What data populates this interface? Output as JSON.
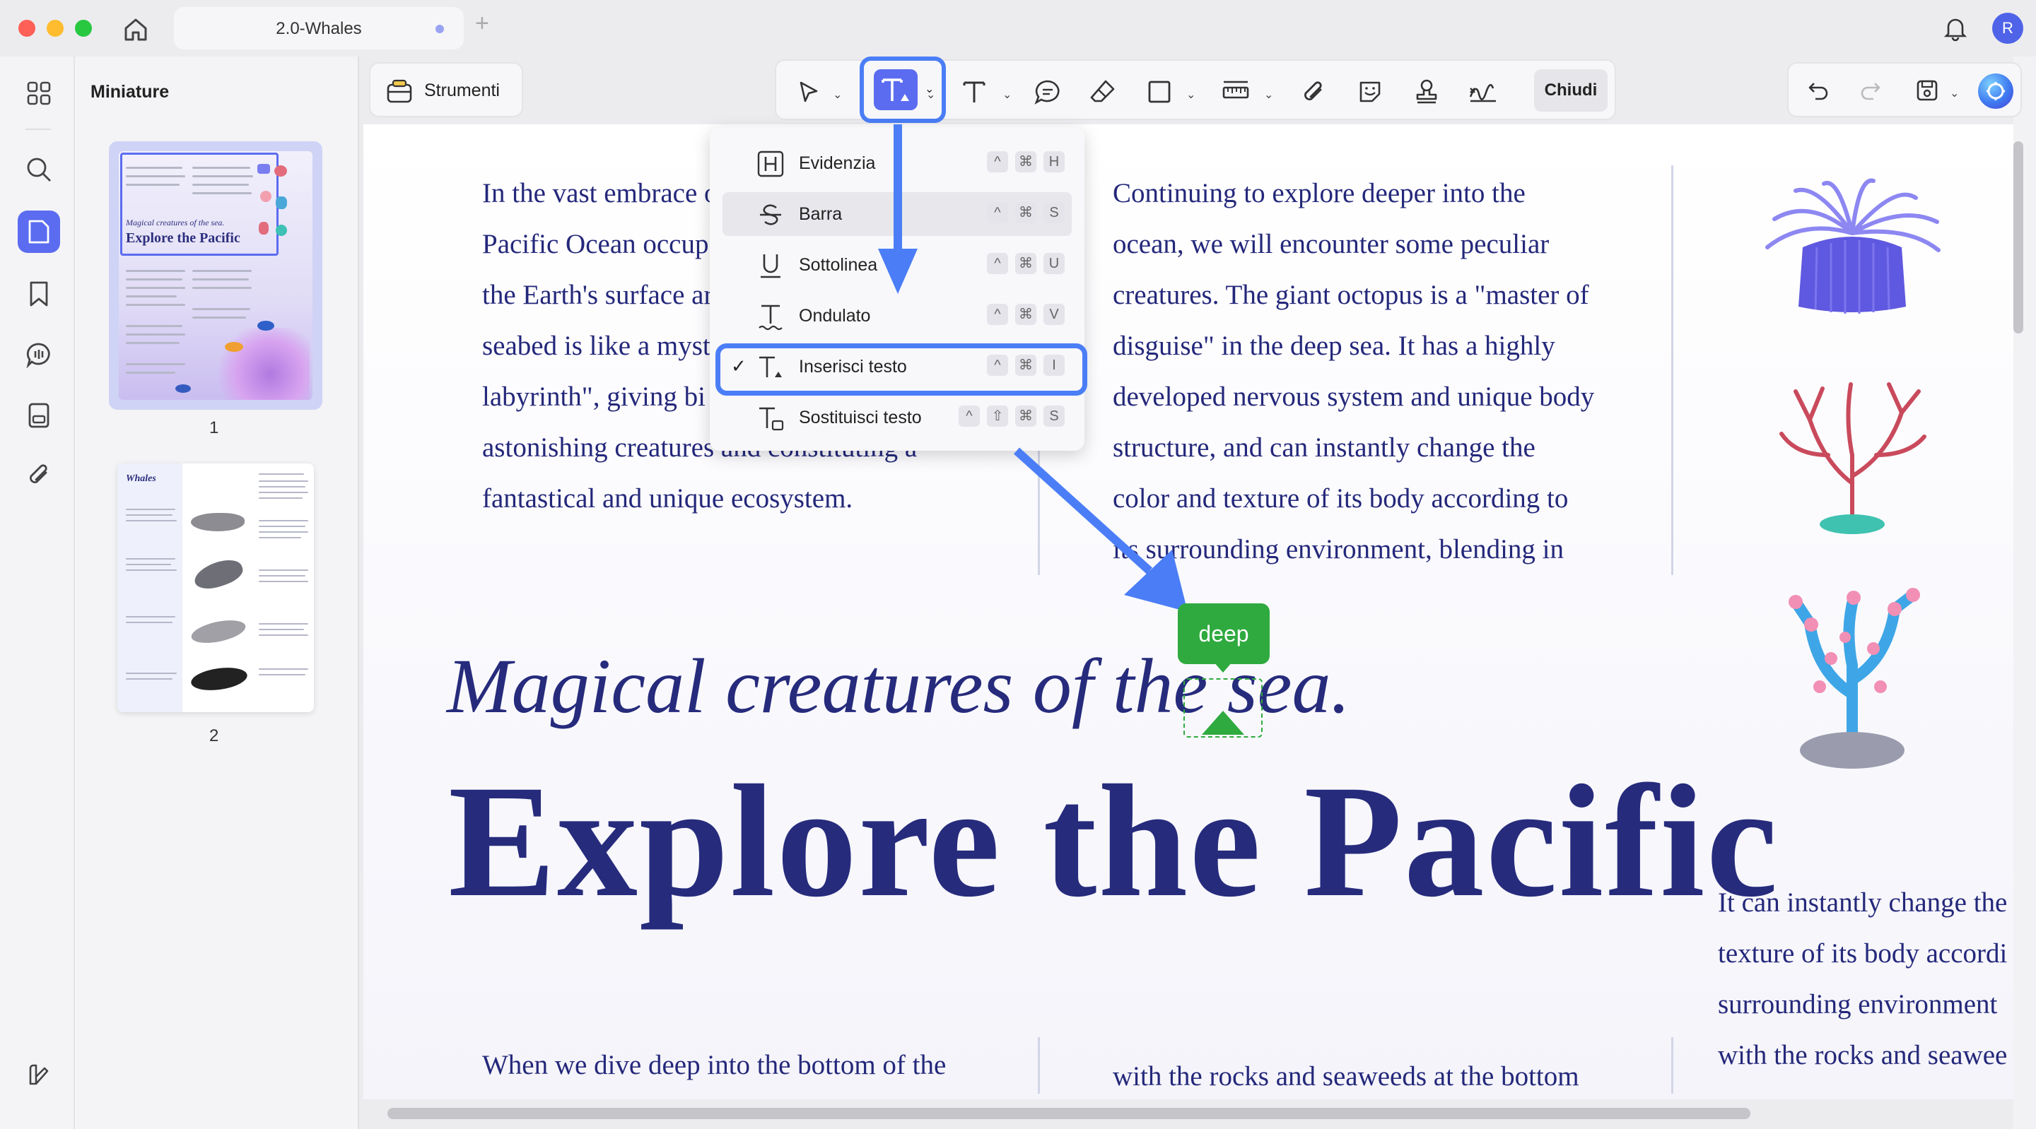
{
  "window": {
    "tab_title": "2.0-Whales",
    "avatar_initial": "R"
  },
  "sidebar": {
    "panel_title": "Miniature",
    "pages": [
      {
        "number": "1",
        "title_small": "Magical creatures of the sea.",
        "title_big": "Explore the Pacific"
      },
      {
        "number": "2",
        "title_small": "Whales"
      }
    ]
  },
  "toolbar": {
    "tools_label": "Strumenti",
    "close_label": "Chiudi"
  },
  "dropdown": {
    "items": [
      {
        "label": "Evidenzia",
        "keys": [
          "^",
          "⌘",
          "H"
        ]
      },
      {
        "label": "Barra",
        "keys": [
          "^",
          "⌘",
          "S"
        ]
      },
      {
        "label": "Sottolinea",
        "keys": [
          "^",
          "⌘",
          "U"
        ]
      },
      {
        "label": "Ondulato",
        "keys": [
          "^",
          "⌘",
          "V"
        ]
      },
      {
        "label": "Inserisci testo",
        "keys": [
          "^",
          "⌘",
          "I"
        ],
        "checked": "✓"
      },
      {
        "label": "Sostituisci testo",
        "keys": [
          "^",
          "⇧",
          "⌘",
          "S"
        ]
      }
    ]
  },
  "document": {
    "col1_top": [
      "In the vast embrace o",
      "Pacific Ocean occup",
      "the Earth's surface ar",
      "seabed is like a myst",
      "labyrinth\", giving bi",
      "astonishing creatures and constituting a",
      "fantastical and unique ecosystem."
    ],
    "col2_top": [
      "Continuing to explore deeper into the",
      "ocean, we will encounter some peculiar",
      "creatures. The giant octopus is a \"master of",
      "disguise\" in the deep sea. It has a highly",
      "developed nervous system and unique body",
      "structure, and can instantly change the",
      "color and texture of its body according to",
      "its surrounding environment, blending in"
    ],
    "subtitle": "Magical creatures of the sea.",
    "heading": "Explore the Pacific",
    "col3_right": [
      "It can instantly change the",
      "texture of its body accordi",
      "surrounding environment",
      "with the rocks and seawee"
    ],
    "col1_bottom": "When we dive deep into the bottom of the",
    "col2_bottom": "with the rocks and seaweeds at the bottom",
    "inserted_text": "deep"
  }
}
